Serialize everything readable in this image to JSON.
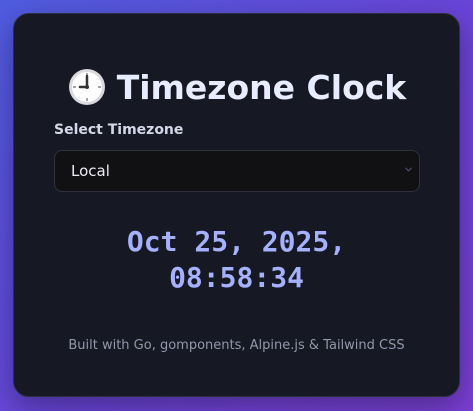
{
  "app": {
    "title": "Timezone Clock",
    "title_icon": "clock-icon"
  },
  "timezone": {
    "label": "Select Timezone",
    "selected": "Local"
  },
  "clock": {
    "date": "Oct 25, 2025,",
    "time": "08:58:34"
  },
  "footer": {
    "text": "Built with Go, gomponents, Alpine.js & Tailwind CSS"
  },
  "colors": {
    "background_start": "#4f5ce0",
    "background_end": "#7a3fd4",
    "card": "#161824",
    "accent": "#a5b0ff",
    "title": "#e8ecff"
  }
}
